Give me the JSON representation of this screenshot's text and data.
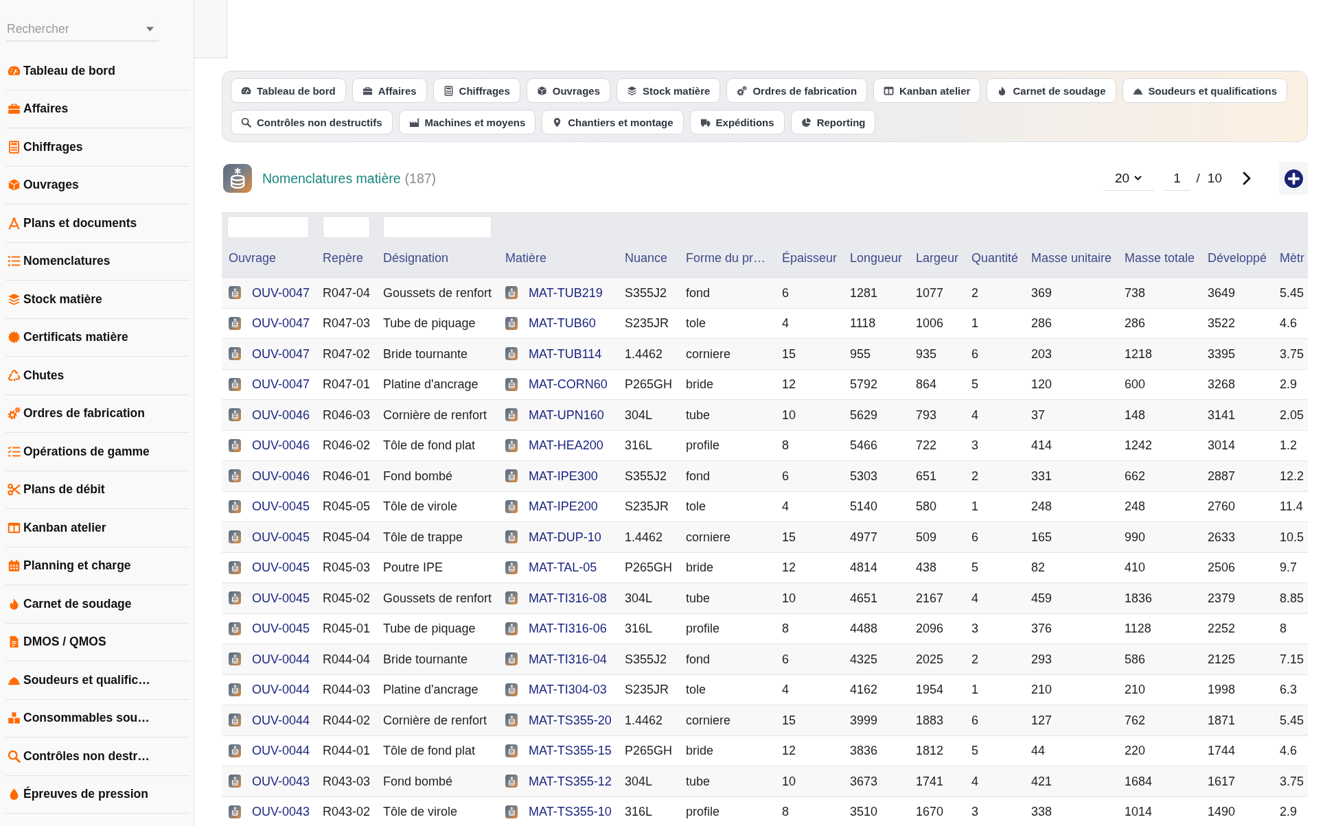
{
  "sidebar": {
    "search": {
      "placeholder": "Rechercher"
    },
    "items": [
      "Tableau de bord",
      "Affaires",
      "Chiffrages",
      "Ouvrages",
      "Plans et documents",
      "Nomenclatures",
      "Stock matière",
      "Certificats matière",
      "Chutes",
      "Ordres de fabrication",
      "Opérations de gamme",
      "Plans de débit",
      "Kanban atelier",
      "Planning et charge",
      "Carnet de soudage",
      "DMOS / QMOS",
      "Soudeurs et qualific…",
      "Consommables sou…",
      "Contrôles non destr…",
      "Épreuves de pression"
    ]
  },
  "nav_tabs": [
    "Tableau de bord",
    "Affaires",
    "Chiffrages",
    "Ouvrages",
    "Stock matière",
    "Ordres de fabrication",
    "Kanban atelier",
    "Carnet de soudage",
    "Soudeurs et qualifications",
    "Contrôles non destructifs",
    "Machines et moyens",
    "Chantiers et montage",
    "Expéditions",
    "Reporting"
  ],
  "header": {
    "title": "Nomenclatures matière",
    "count": "(187)"
  },
  "pagination": {
    "page_size": "20",
    "page": "1",
    "separator": "/",
    "total_pages": "10"
  },
  "table": {
    "columns": [
      "Ouvrage",
      "Repère",
      "Désignation",
      "Matière",
      "Nuance",
      "Forme du pr…",
      "Épaisseur",
      "Longueur",
      "Largeur",
      "Quantité",
      "Masse unitaire",
      "Masse totale",
      "Développé",
      "Mètr"
    ],
    "rows": [
      [
        "OUV-0047",
        "R047-04",
        "Goussets de renfort",
        "MAT-TUB219",
        "S355J2",
        "fond",
        "6",
        "1281",
        "1077",
        "2",
        "369",
        "738",
        "3649",
        "5.45"
      ],
      [
        "OUV-0047",
        "R047-03",
        "Tube de piquage",
        "MAT-TUB60",
        "S235JR",
        "tole",
        "4",
        "1118",
        "1006",
        "1",
        "286",
        "286",
        "3522",
        "4.6"
      ],
      [
        "OUV-0047",
        "R047-02",
        "Bride tournante",
        "MAT-TUB114",
        "1.4462",
        "corniere",
        "15",
        "955",
        "935",
        "6",
        "203",
        "1218",
        "3395",
        "3.75"
      ],
      [
        "OUV-0047",
        "R047-01",
        "Platine d'ancrage",
        "MAT-CORN60",
        "P265GH",
        "bride",
        "12",
        "5792",
        "864",
        "5",
        "120",
        "600",
        "3268",
        "2.9"
      ],
      [
        "OUV-0046",
        "R046-03",
        "Cornière de renfort",
        "MAT-UPN160",
        "304L",
        "tube",
        "10",
        "5629",
        "793",
        "4",
        "37",
        "148",
        "3141",
        "2.05"
      ],
      [
        "OUV-0046",
        "R046-02",
        "Tôle de fond plat",
        "MAT-HEA200",
        "316L",
        "profile",
        "8",
        "5466",
        "722",
        "3",
        "414",
        "1242",
        "3014",
        "1.2"
      ],
      [
        "OUV-0046",
        "R046-01",
        "Fond bombé",
        "MAT-IPE300",
        "S355J2",
        "fond",
        "6",
        "5303",
        "651",
        "2",
        "331",
        "662",
        "2887",
        "12.2"
      ],
      [
        "OUV-0045",
        "R045-05",
        "Tôle de virole",
        "MAT-IPE200",
        "S235JR",
        "tole",
        "4",
        "5140",
        "580",
        "1",
        "248",
        "248",
        "2760",
        "11.4"
      ],
      [
        "OUV-0045",
        "R045-04",
        "Tôle de trappe",
        "MAT-DUP-10",
        "1.4462",
        "corniere",
        "15",
        "4977",
        "509",
        "6",
        "165",
        "990",
        "2633",
        "10.5"
      ],
      [
        "OUV-0045",
        "R045-03",
        "Poutre IPE",
        "MAT-TAL-05",
        "P265GH",
        "bride",
        "12",
        "4814",
        "438",
        "5",
        "82",
        "410",
        "2506",
        "9.7"
      ],
      [
        "OUV-0045",
        "R045-02",
        "Goussets de renfort",
        "MAT-TI316-08",
        "304L",
        "tube",
        "10",
        "4651",
        "2167",
        "4",
        "459",
        "1836",
        "2379",
        "8.85"
      ],
      [
        "OUV-0045",
        "R045-01",
        "Tube de piquage",
        "MAT-TI316-06",
        "316L",
        "profile",
        "8",
        "4488",
        "2096",
        "3",
        "376",
        "1128",
        "2252",
        "8"
      ],
      [
        "OUV-0044",
        "R044-04",
        "Bride tournante",
        "MAT-TI316-04",
        "S355J2",
        "fond",
        "6",
        "4325",
        "2025",
        "2",
        "293",
        "586",
        "2125",
        "7.15"
      ],
      [
        "OUV-0044",
        "R044-03",
        "Platine d'ancrage",
        "MAT-TI304-03",
        "S235JR",
        "tole",
        "4",
        "4162",
        "1954",
        "1",
        "210",
        "210",
        "1998",
        "6.3"
      ],
      [
        "OUV-0044",
        "R044-02",
        "Cornière de renfort",
        "MAT-TS355-20",
        "1.4462",
        "corniere",
        "15",
        "3999",
        "1883",
        "6",
        "127",
        "762",
        "1871",
        "5.45"
      ],
      [
        "OUV-0044",
        "R044-01",
        "Tôle de fond plat",
        "MAT-TS355-15",
        "P265GH",
        "bride",
        "12",
        "3836",
        "1812",
        "5",
        "44",
        "220",
        "1744",
        "4.6"
      ],
      [
        "OUV-0043",
        "R043-03",
        "Fond bombé",
        "MAT-TS355-12",
        "304L",
        "tube",
        "10",
        "3673",
        "1741",
        "4",
        "421",
        "1684",
        "1617",
        "3.75"
      ],
      [
        "OUV-0043",
        "R043-02",
        "Tôle de virole",
        "MAT-TS355-10",
        "316L",
        "profile",
        "8",
        "3510",
        "1670",
        "3",
        "338",
        "1014",
        "1490",
        "2.9"
      ]
    ]
  }
}
